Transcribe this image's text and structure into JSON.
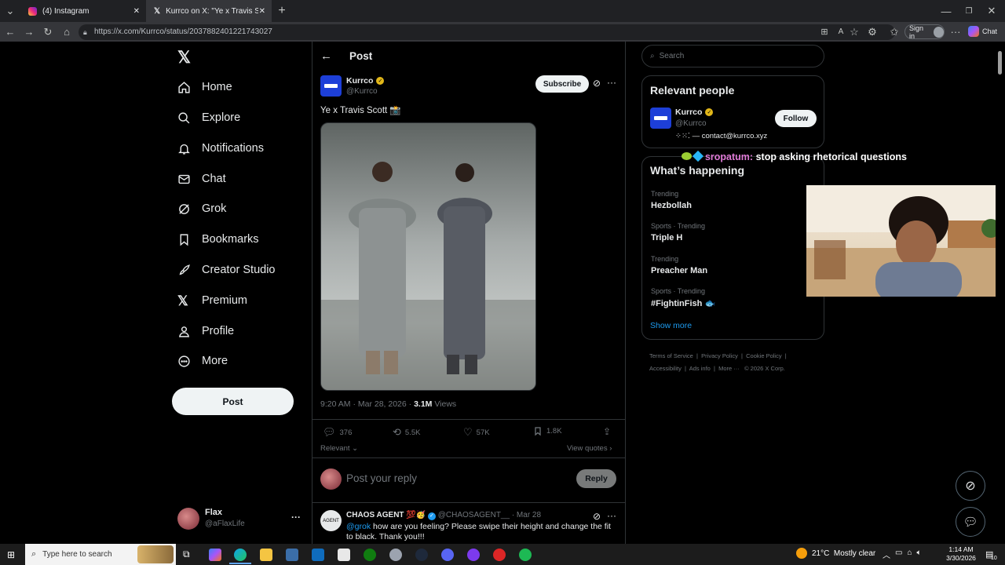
{
  "browser": {
    "tabs": [
      {
        "label": "(4) Instagram"
      },
      {
        "label": "Kurrco on X: \"Ye x Travis Scott 📸\" / X"
      }
    ],
    "url": "https://x.com/Kurrco/status/2037882401221743027",
    "sign_in": "Sign in",
    "chat": "Chat"
  },
  "nav": {
    "items": [
      "Home",
      "Explore",
      "Notifications",
      "Chat",
      "Grok",
      "Bookmarks",
      "Creator Studio",
      "Premium",
      "Profile",
      "More"
    ],
    "post_button": "Post",
    "account_name": "Flax",
    "account_handle": "@aFlaxLife"
  },
  "post": {
    "header_title": "Post",
    "author_name": "Kurrco",
    "author_handle": "@Kurrco",
    "subscribe": "Subscribe",
    "text": "Ye x Travis Scott 📸",
    "timestamp": "9:20 AM · Mar 28, 2026 ·",
    "views_count": "3.1M",
    "views_label": "Views",
    "replies": "376",
    "reposts": "5.5K",
    "likes": "57K",
    "bookmarks": "1.8K",
    "relevant": "Relevant",
    "view_quotes": "View quotes",
    "reply_placeholder": "Post your reply",
    "reply_button": "Reply"
  },
  "reply": {
    "author": "CHAOS AGENT 💯🥳",
    "handle": "@CHAOSAGENT__ · Mar 28",
    "mention": "@grok",
    "text": "how are you feeling? Please swipe their height and change the fit to black. Thank you!!!"
  },
  "sidebar": {
    "search_placeholder": "Search",
    "relevant_title": "Relevant people",
    "person_name": "Kurrco",
    "person_handle": "@Kurrco",
    "person_bio": "⁘⁙⁚ — contact@kurrco.xyz",
    "follow": "Follow",
    "happening_title": "What’s happening",
    "trends": [
      {
        "meta": "Trending",
        "title": "Hezbollah"
      },
      {
        "meta": "Sports · Trending",
        "title": "Triple H"
      },
      {
        "meta": "Trending",
        "title": "Preacher Man"
      },
      {
        "meta": "Sports · Trending",
        "title": "#FightinFish 🐟"
      }
    ],
    "show_more": "Show more",
    "footer": [
      "Terms of Service",
      "Privacy Policy",
      "Cookie Policy",
      "Accessibility",
      "Ads info",
      "More ···",
      "© 2026 X Corp."
    ]
  },
  "overlay": {
    "chat_user": "sropatum",
    "chat_message": "stop asking rhetorical questions"
  },
  "taskbar": {
    "search_placeholder": "Type here to search",
    "weather": "21°C  Mostly clear",
    "time": "1:14 AM",
    "date": "3/30/2026",
    "notif_count": "10"
  }
}
